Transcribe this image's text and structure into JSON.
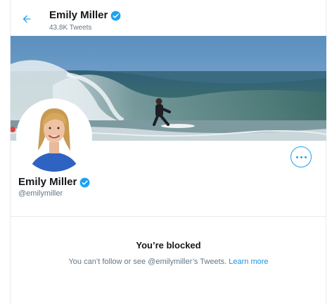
{
  "header": {
    "name": "Emily Miller",
    "tweet_count": "43.8K Tweets"
  },
  "profile": {
    "name": "Emily Miller",
    "handle": "@emilymiller",
    "verified": true
  },
  "blocked": {
    "title": "You’re blocked",
    "message": "You can’t follow or see @emilymiller’s Tweets.",
    "learn_more": "Learn more"
  },
  "icons": {
    "back": "back-arrow-icon",
    "verified": "verified-badge-icon",
    "more": "more-options-icon"
  },
  "colors": {
    "accent": "#1da1f2",
    "link": "#1b95e0",
    "muted": "#657786",
    "text": "#14171a"
  }
}
